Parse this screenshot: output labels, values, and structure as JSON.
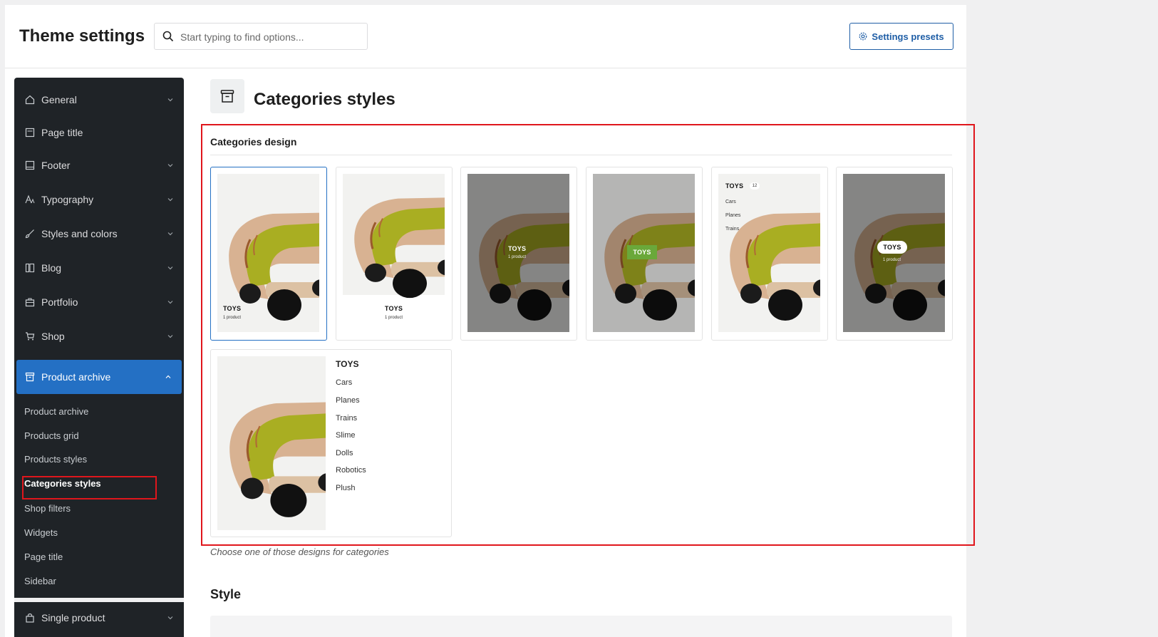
{
  "header": {
    "title": "Theme settings",
    "search_placeholder": "Start typing to find options...",
    "presets_label": "Settings presets"
  },
  "sidebar": {
    "items": [
      {
        "label": "General",
        "icon": "home-icon"
      },
      {
        "label": "Page title",
        "icon": "page-icon"
      },
      {
        "label": "Footer",
        "icon": "footer-icon"
      },
      {
        "label": "Typography",
        "icon": "typography-icon"
      },
      {
        "label": "Styles and colors",
        "icon": "brush-icon"
      },
      {
        "label": "Blog",
        "icon": "blog-icon"
      },
      {
        "label": "Portfolio",
        "icon": "briefcase-icon"
      },
      {
        "label": "Shop",
        "icon": "cart-icon"
      },
      {
        "label": "Product archive",
        "icon": "archive-icon"
      },
      {
        "label": "Single product",
        "icon": "bag-icon"
      }
    ],
    "sub_items": [
      "Product archive",
      "Products grid",
      "Products styles",
      "Categories styles",
      "Shop filters",
      "Widgets",
      "Page title",
      "Sidebar"
    ],
    "current_sub": "Categories styles"
  },
  "main": {
    "section_title": "Categories styles",
    "group_title": "Categories design",
    "help_text": "Choose one of those designs for categories",
    "style_title": "Style"
  },
  "designs": {
    "d1": {
      "label": "TOYS",
      "count": "1 product"
    },
    "d2": {
      "label": "TOYS",
      "count": "1 product"
    },
    "d3": {
      "label": "TOYS",
      "count": "1 product"
    },
    "d4": {
      "label": "TOYS"
    },
    "d5": {
      "label": "TOYS",
      "badge": "12",
      "subs": [
        "Cars",
        "Planes",
        "Trains"
      ]
    },
    "d6": {
      "label": "TOYS",
      "count": "1 product"
    },
    "d7": {
      "label": "TOYS",
      "subs": [
        "Cars",
        "Planes",
        "Trains",
        "Slime",
        "Dolls",
        "Robotics",
        "Plush"
      ]
    }
  },
  "colors": {
    "sidebar_bg": "#1f2327",
    "accent": "#2470c4",
    "highlight": "#e0161c",
    "toy_green": "#a7ad1f",
    "badge_green": "#6aa83a"
  }
}
